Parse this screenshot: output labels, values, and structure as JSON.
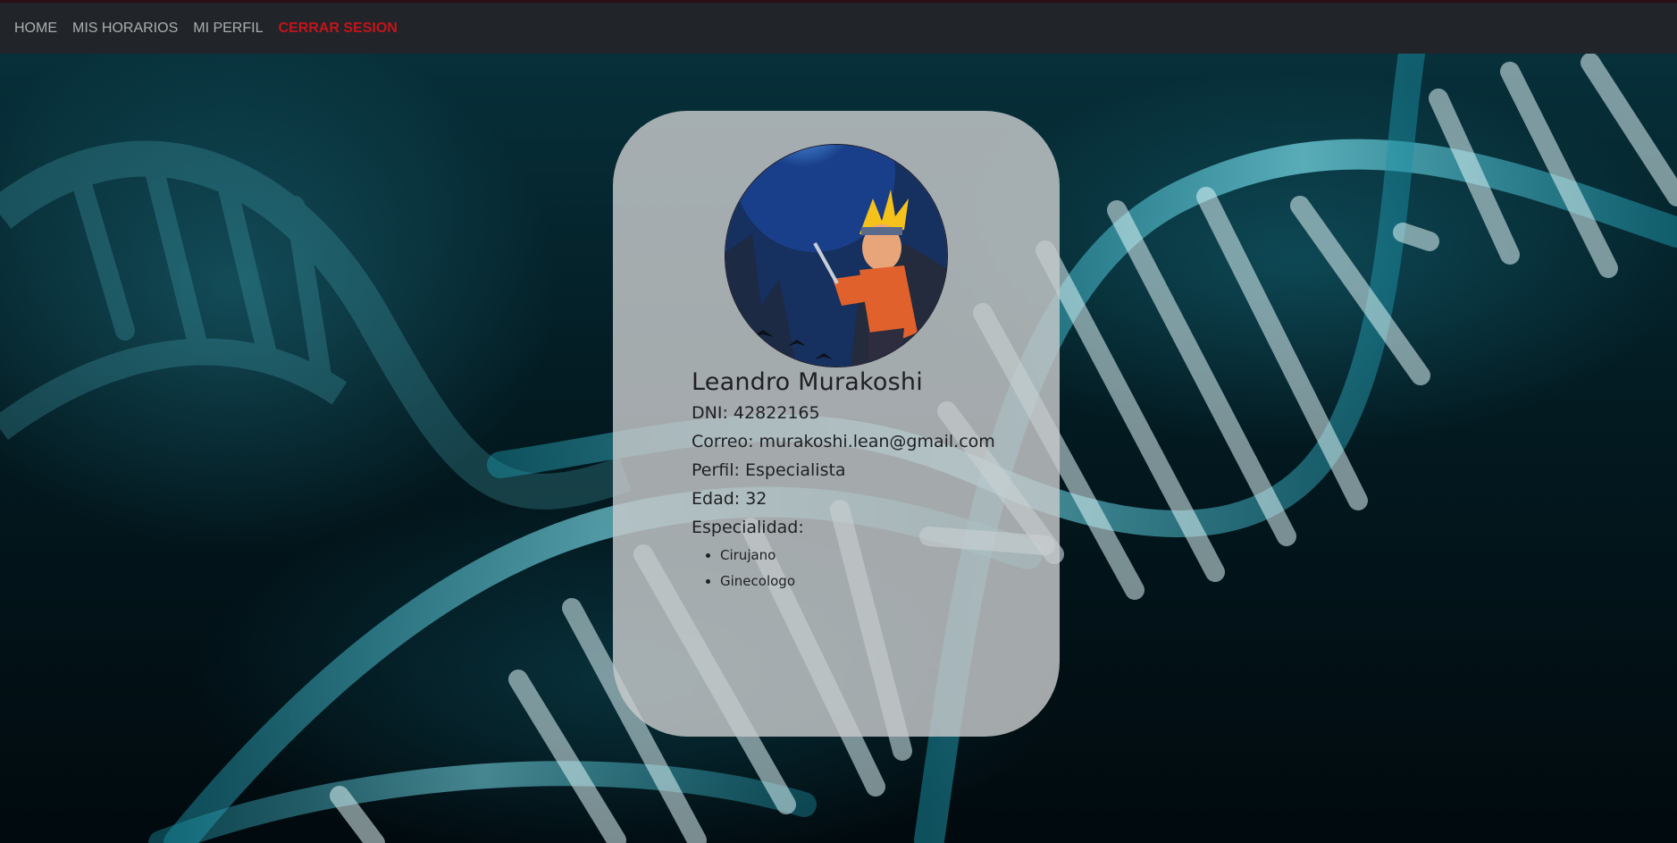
{
  "navbar": {
    "items": [
      {
        "label": "HOME"
      },
      {
        "label": "MIS HORARIOS"
      },
      {
        "label": "MI PERFIL"
      }
    ],
    "logout_label": "CERRAR SESION",
    "logout_color": "#c4141a"
  },
  "profile": {
    "name": "Leandro Murakoshi",
    "dni_label": "DNI:",
    "dni": "42822165",
    "email_label": "Correo:",
    "email": "murakoshi.lean@gmail.com",
    "perfil_label": "Perfil:",
    "perfil": "Especialista",
    "edad_label": "Edad:",
    "edad": "32",
    "especialidad_label": "Especialidad:",
    "especialidades": [
      "Cirujano",
      "Ginecologo"
    ]
  }
}
